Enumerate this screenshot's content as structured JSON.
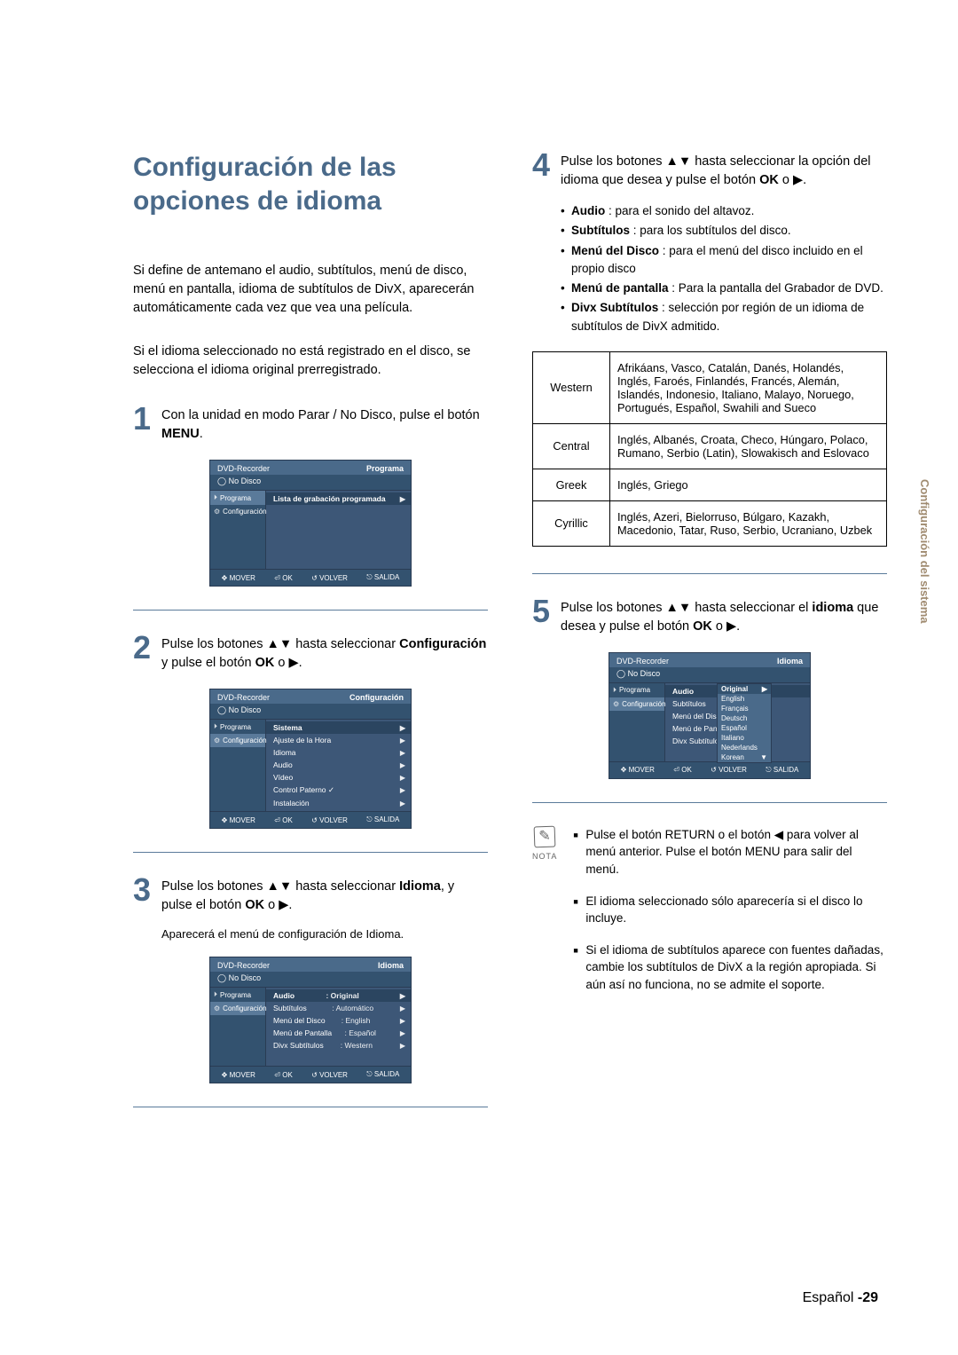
{
  "title": "Configuración de las opciones de idioma",
  "intro1": "Si define de antemano el audio, subtítulos, menú de disco, menú en pantalla, idioma de subtítulos de DivX, aparecerán automáticamente cada vez que vea una película.",
  "intro2": "Si el idioma seleccionado no está registrado en el disco, se selecciona el idioma original prerregistrado.",
  "step1": {
    "num": "1",
    "t1": "Con la unidad en modo Parar / No Disco, pulse el botón ",
    "b": "MENU",
    "t2": "."
  },
  "step2": {
    "num": "2",
    "t1": "Pulse los botones ▲▼ hasta seleccionar ",
    "b": "Configuración",
    "t2": " y pulse el botón ",
    "b2": "OK",
    "t3": " o ▶."
  },
  "step3": {
    "num": "3",
    "t1": "Pulse los botones ▲▼ hasta seleccionar ",
    "b": "Idioma",
    "t2": ", y pulse el botón ",
    "b2": "OK",
    "t3": " o ▶.",
    "sub": "Aparecerá el menú de configuración de Idioma."
  },
  "step4": {
    "num": "4",
    "t1": "Pulse los botones ▲▼ hasta seleccionar la opción del idioma que desea y pulse el botón ",
    "b2": "OK",
    "t3": " o ▶."
  },
  "step5": {
    "num": "5",
    "t1": "Pulse los botones ▲▼ hasta seleccionar el ",
    "b": "idioma",
    "t2": " que desea y pulse el botón ",
    "b2": "OK",
    "t3": " o ▶."
  },
  "bullets4": [
    {
      "b": "Audio",
      "t": " : para el sonido del altavoz."
    },
    {
      "b": "Subtítulos",
      "t": " : para los subtítulos del disco."
    },
    {
      "b": "Menú del Disco",
      "t": " : para el menú del disco incluido en el propio disco"
    },
    {
      "b": "Menú de pantalla",
      "t": " : Para la pantalla del Grabador de DVD."
    },
    {
      "b": "Divx Subtítulos",
      "t": " : selección por región de un idioma de subtítulos de DivX admitido."
    }
  ],
  "table": [
    {
      "k": "Western",
      "v": "Afrikáans, Vasco, Catalán, Danés, Holandés, Inglés, Faroés, Finlandés, Francés, Alemán, Islandés, Indonesio, Italiano, Malayo, Noruego, Portugués, Español, Swahili and Sueco"
    },
    {
      "k": "Central",
      "v": "Inglés, Albanés, Croata, Checo, Húngaro, Polaco, Rumano, Serbio (Latin), Slowakisch and Eslovaco"
    },
    {
      "k": "Greek",
      "v": "Inglés, Griego"
    },
    {
      "k": "Cyrillic",
      "v": "Inglés, Azeri, Bielorruso, Búlgaro, Kazakh, Macedonio, Tatar, Ruso, Serbio, Ucraniano, Uzbek"
    }
  ],
  "notes": [
    "Pulse el botón RETURN o el botón ◀ para volver al menú anterior. Pulse el botón MENU para salir del menú.",
    "El idioma seleccionado sólo aparecería si el disco lo incluye.",
    "Si el idioma de subtítulos aparece con fuentes dañadas, cambie los subtítulos de DivX a la región apropiada. Si aún así no funciona, no se admite el soporte."
  ],
  "note_label": "NOTA",
  "side_label": "Configuración del sistema",
  "footer": {
    "lang": "Español",
    "page": "-29"
  },
  "screens": {
    "common": {
      "title": "DVD-Recorder",
      "nodisc": "No Disco",
      "side_prog": "Programa",
      "side_conf": "Configuración",
      "foot_mover": "MOVER",
      "foot_ok": "OK",
      "foot_volver": "VOLVER",
      "foot_salida": "SALIDA"
    },
    "s1": {
      "hdrR": "Programa",
      "row": "Lista de grabación programada"
    },
    "s2": {
      "hdrR": "Configuración",
      "rows": [
        "Sistema",
        "Ajuste de la Hora",
        "Idioma",
        "Audio",
        "Vídeo",
        "Control Paterno ✓",
        "Instalación"
      ]
    },
    "s3": {
      "hdrR": "Idioma",
      "rows": [
        {
          "l": "Audio",
          "v": ": Original"
        },
        {
          "l": "Subtítulos",
          "v": ": Automático"
        },
        {
          "l": "Menú del Disco",
          "v": ": English"
        },
        {
          "l": "Menú de Pantalla",
          "v": ": Español"
        },
        {
          "l": "Divx Subtítulos",
          "v": ": Western"
        }
      ]
    },
    "s5": {
      "hdrR": "Idioma",
      "left": [
        "Audio",
        "Subtítulos",
        "Menú del Disco",
        "Menú de Pantalla",
        "Divx Subtítulos"
      ],
      "popup": [
        "Original",
        "English",
        "Français",
        "Deutsch",
        "Español",
        "Italiano",
        "Nederlands",
        "Korean"
      ]
    }
  }
}
